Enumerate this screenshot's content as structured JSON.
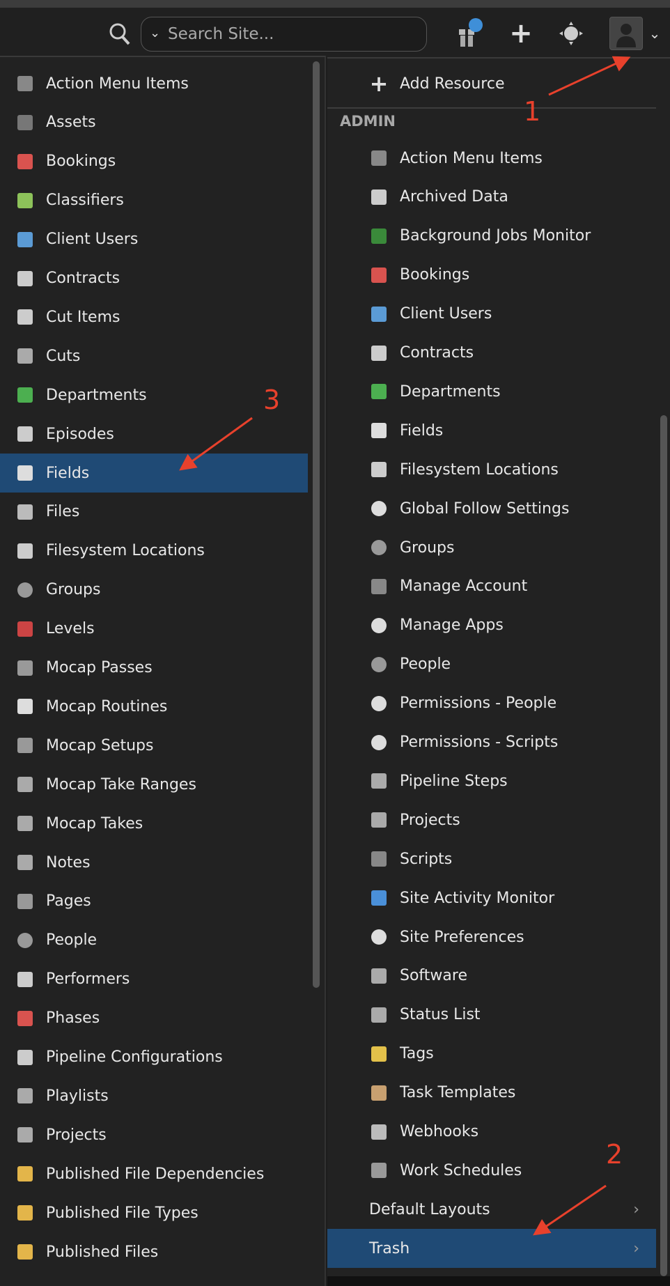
{
  "topbar": {
    "search_placeholder": "Search Site..."
  },
  "left_menu": {
    "items": [
      {
        "label": "Action Menu Items",
        "icon": "action-menu-icon",
        "color": "#888"
      },
      {
        "label": "Assets",
        "icon": "asset-cube-icon",
        "color": "#777"
      },
      {
        "label": "Bookings",
        "icon": "booking-icon",
        "color": "#d9534f"
      },
      {
        "label": "Classifiers",
        "icon": "classifier-icon",
        "color": "#8dc25a"
      },
      {
        "label": "Client Users",
        "icon": "client-user-icon",
        "color": "#5b9bd5"
      },
      {
        "label": "Contracts",
        "icon": "contract-icon",
        "color": "#ccc"
      },
      {
        "label": "Cut Items",
        "icon": "folder-icon",
        "color": "#ccc"
      },
      {
        "label": "Cuts",
        "icon": "clapper-icon",
        "color": "#aaa"
      },
      {
        "label": "Departments",
        "icon": "department-tree-icon",
        "color": "#4caf50"
      },
      {
        "label": "Episodes",
        "icon": "tv-icon",
        "color": "#ccc"
      },
      {
        "label": "Fields",
        "icon": "field-icon",
        "color": "#ddd",
        "selected": true
      },
      {
        "label": "Files",
        "icon": "file-icon",
        "color": "#bbb"
      },
      {
        "label": "Filesystem Locations",
        "icon": "folder-icon",
        "color": "#ccc"
      },
      {
        "label": "Groups",
        "icon": "group-icon",
        "color": "#999"
      },
      {
        "label": "Levels",
        "icon": "level-icon",
        "color": "#c44"
      },
      {
        "label": "Mocap Passes",
        "icon": "mocap-pass-icon",
        "color": "#999"
      },
      {
        "label": "Mocap Routines",
        "icon": "mocap-routine-icon",
        "color": "#ddd"
      },
      {
        "label": "Mocap Setups",
        "icon": "mocap-setup-icon",
        "color": "#999"
      },
      {
        "label": "Mocap Take Ranges",
        "icon": "film-icon",
        "color": "#aaa"
      },
      {
        "label": "Mocap Takes",
        "icon": "clapper-icon",
        "color": "#aaa"
      },
      {
        "label": "Notes",
        "icon": "note-icon",
        "color": "#aaa"
      },
      {
        "label": "Pages",
        "icon": "pages-grid-icon",
        "color": "#999"
      },
      {
        "label": "People",
        "icon": "person-icon",
        "color": "#999"
      },
      {
        "label": "Performers",
        "icon": "performer-icon",
        "color": "#ccc"
      },
      {
        "label": "Phases",
        "icon": "phase-icon",
        "color": "#d9534f"
      },
      {
        "label": "Pipeline Configurations",
        "icon": "tools-icon",
        "color": "#ccc"
      },
      {
        "label": "Playlists",
        "icon": "playlist-icon",
        "color": "#aaa"
      },
      {
        "label": "Projects",
        "icon": "project-icon",
        "color": "#aaa"
      },
      {
        "label": "Published File Dependencies",
        "icon": "published-file-icon",
        "color": "#e3b54a"
      },
      {
        "label": "Published File Types",
        "icon": "published-file-icon",
        "color": "#e3b54a"
      },
      {
        "label": "Published Files",
        "icon": "published-file-icon",
        "color": "#e3b54a"
      }
    ]
  },
  "right_menu": {
    "add_resource": "Add Resource",
    "section": "ADMIN",
    "items": [
      {
        "label": "Action Menu Items",
        "icon": "action-menu-icon",
        "color": "#888"
      },
      {
        "label": "Archived Data",
        "icon": "archive-icon",
        "color": "#ccc"
      },
      {
        "label": "Background Jobs Monitor",
        "icon": "ftr-icon",
        "color": "#3a8a3a"
      },
      {
        "label": "Bookings",
        "icon": "booking-icon",
        "color": "#d9534f"
      },
      {
        "label": "Client Users",
        "icon": "client-user-icon",
        "color": "#5b9bd5"
      },
      {
        "label": "Contracts",
        "icon": "contract-icon",
        "color": "#ccc"
      },
      {
        "label": "Departments",
        "icon": "department-tree-icon",
        "color": "#4caf50"
      },
      {
        "label": "Fields",
        "icon": "field-icon",
        "color": "#ddd"
      },
      {
        "label": "Filesystem Locations",
        "icon": "folder-icon",
        "color": "#ccc"
      },
      {
        "label": "Global Follow Settings",
        "icon": "gear-icon",
        "color": "#ddd"
      },
      {
        "label": "Groups",
        "icon": "group-icon",
        "color": "#999"
      },
      {
        "label": "Manage Account",
        "icon": "share-arrow-icon",
        "color": "#888"
      },
      {
        "label": "Manage Apps",
        "icon": "gear-icon",
        "color": "#ddd"
      },
      {
        "label": "People",
        "icon": "person-icon",
        "color": "#999"
      },
      {
        "label": "Permissions - People",
        "icon": "lock-icon",
        "color": "#ddd"
      },
      {
        "label": "Permissions - Scripts",
        "icon": "lock-icon",
        "color": "#ddd"
      },
      {
        "label": "Pipeline Steps",
        "icon": "pipeline-icon",
        "color": "#aaa"
      },
      {
        "label": "Projects",
        "icon": "project-icon",
        "color": "#aaa"
      },
      {
        "label": "Scripts",
        "icon": "terminal-icon",
        "color": "#888"
      },
      {
        "label": "Site Activity Monitor",
        "icon": "activity-monitor-icon",
        "color": "#4a90d9"
      },
      {
        "label": "Site Preferences",
        "icon": "gear-icon",
        "color": "#ddd"
      },
      {
        "label": "Software",
        "icon": "software-disc-icon",
        "color": "#aaa"
      },
      {
        "label": "Status List",
        "icon": "flag-icon",
        "color": "#aaa"
      },
      {
        "label": "Tags",
        "icon": "tag-icon",
        "color": "#e3c14a"
      },
      {
        "label": "Task Templates",
        "icon": "stamp-icon",
        "color": "#c8a070"
      },
      {
        "label": "Webhooks",
        "icon": "webhook-icon",
        "color": "#bbb"
      },
      {
        "label": "Work Schedules",
        "icon": "calendar-grid-icon",
        "color": "#999"
      }
    ],
    "submenus": [
      {
        "label": "Default Layouts"
      },
      {
        "label": "Trash",
        "selected": true
      }
    ]
  },
  "annotations": [
    "1",
    "2",
    "3"
  ],
  "colors": {
    "selected": "#1f4a75",
    "annotation": "#e8412c",
    "badge": "#3f8fd8"
  }
}
